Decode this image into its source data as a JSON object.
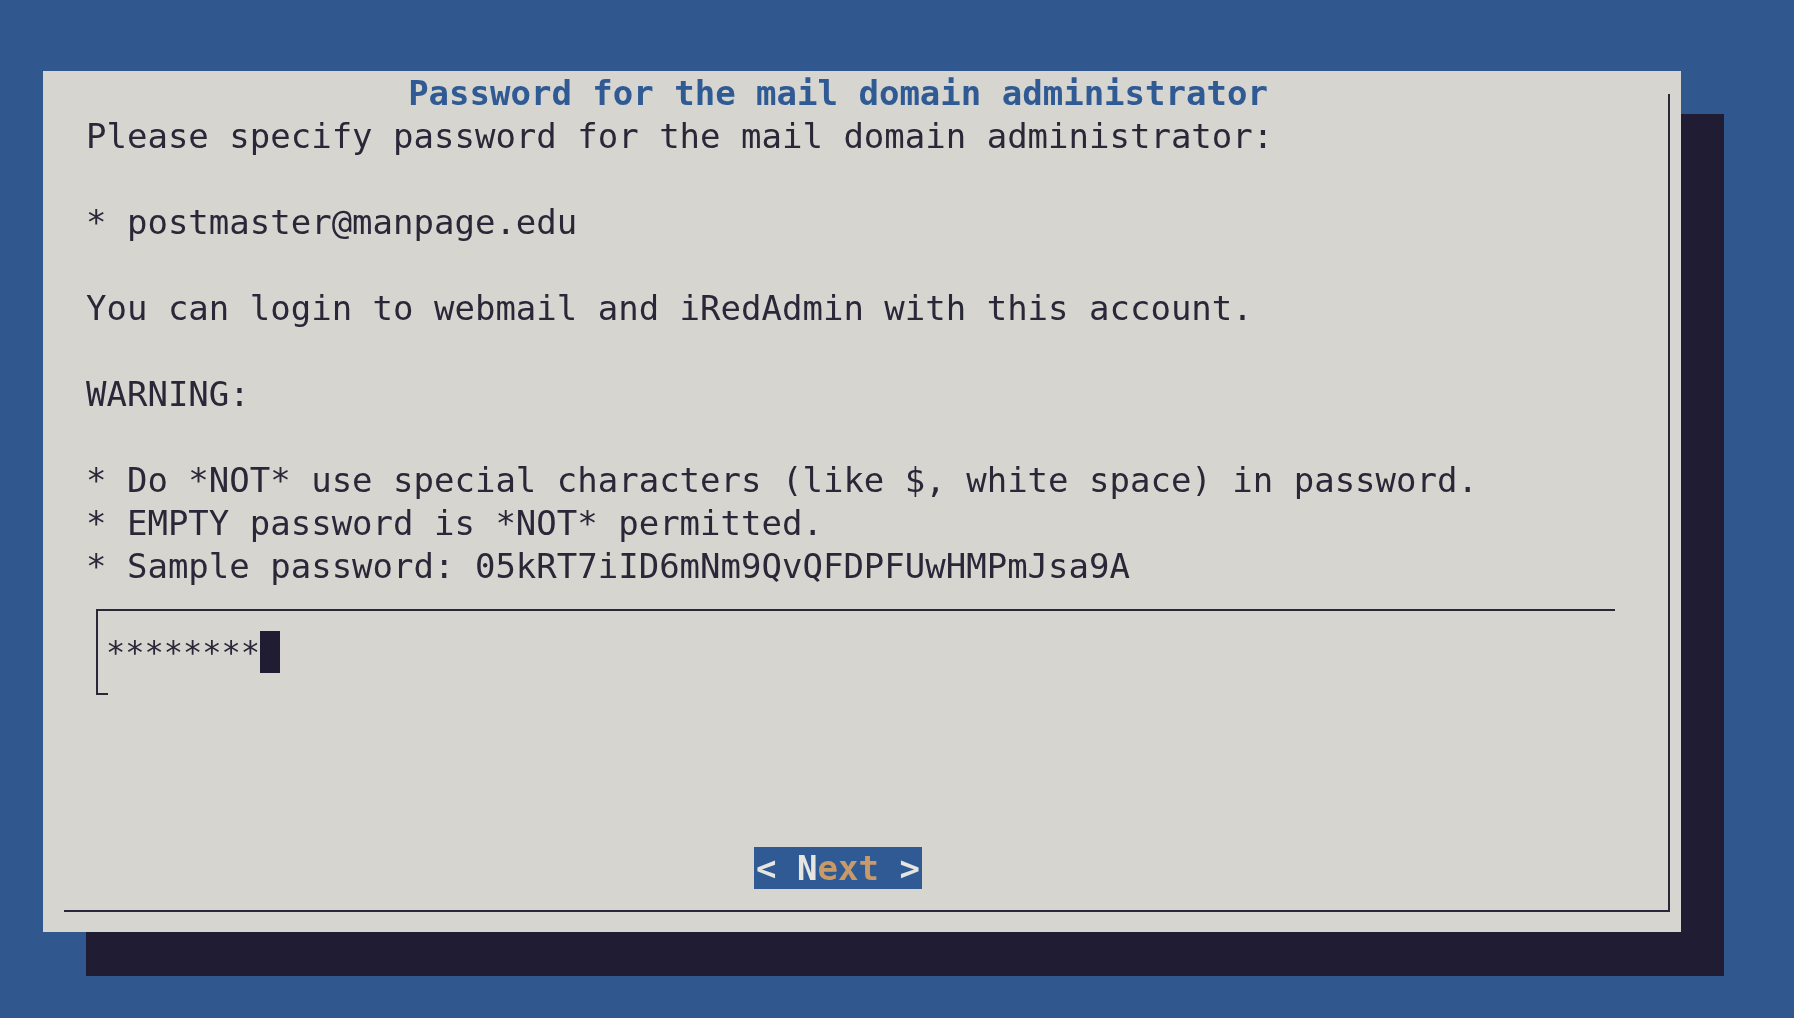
{
  "dialog": {
    "title": "Password for the mail domain administrator",
    "message": [
      [
        "Please specify password for the mail domain administrator:"
      ],
      [
        "* postmaster@manpage.edu"
      ],
      [
        "You can login to webmail and iRedAdmin with this account."
      ],
      [
        "WARNING:"
      ],
      [
        "* Do *NOT* use special characters (like $, white space) in password.",
        "* EMPTY password is *NOT* permitted.",
        "* Sample password: 05kRT7iID6mNm9QvQFDPFUwHMPmJsa9A"
      ]
    ],
    "password_field": {
      "value": "********"
    },
    "buttons": [
      {
        "left": "<",
        "label": "Next",
        "right": ">",
        "selected": true
      }
    ]
  }
}
